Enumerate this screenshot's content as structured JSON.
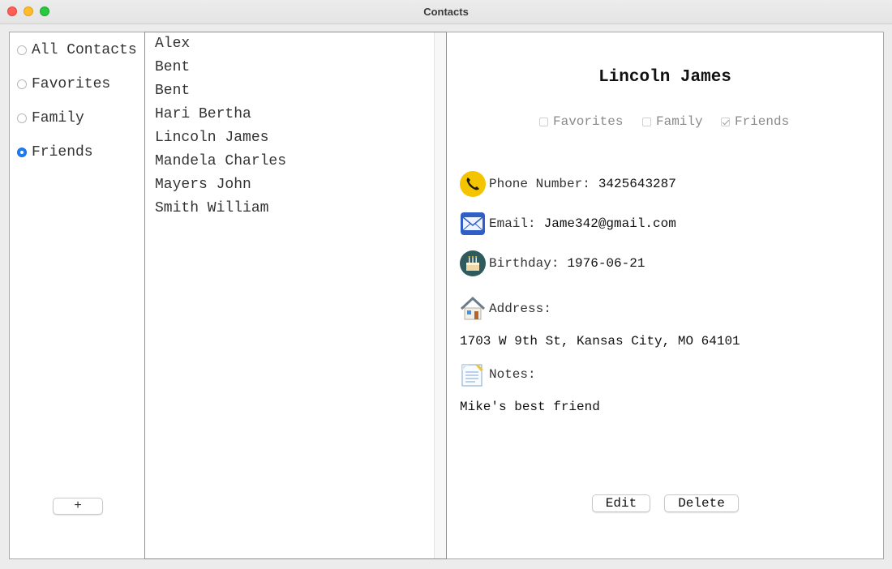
{
  "window": {
    "title": "Contacts"
  },
  "sidebar": {
    "groups": [
      {
        "label": "All Contacts",
        "selected": false
      },
      {
        "label": "Favorites",
        "selected": false
      },
      {
        "label": "Family",
        "selected": false
      },
      {
        "label": "Friends",
        "selected": true
      }
    ],
    "add_label": "+"
  },
  "contact_list": {
    "items": [
      "Alex",
      "Bent",
      "Bent",
      "Hari Bertha",
      "Lincoln James",
      "Mandela Charles",
      "Mayers John",
      "Smith William"
    ]
  },
  "detail": {
    "name": "Lincoln James",
    "tags": [
      {
        "label": "Favorites",
        "checked": false
      },
      {
        "label": "Family",
        "checked": false
      },
      {
        "label": "Friends",
        "checked": true
      }
    ],
    "phone": {
      "label": "Phone Number:",
      "value": "3425643287",
      "icon": "phone-icon"
    },
    "email": {
      "label": "Email:",
      "value": "Jame342@gmail.com",
      "icon": "envelope-icon"
    },
    "birthday": {
      "label": "Birthday:",
      "value": "1976-06-21",
      "icon": "cake-icon"
    },
    "address": {
      "label": "Address:",
      "value": "1703 W 9th St, Kansas City, MO 64101",
      "icon": "house-icon"
    },
    "notes": {
      "label": "Notes:",
      "value": "Mike's best friend",
      "icon": "notepad-icon"
    },
    "edit_label": "Edit",
    "delete_label": "Delete"
  },
  "colors": {
    "accent": "#1f7cf7",
    "phone_badge": "#f5c400",
    "birthday_badge": "#2f5a5e"
  }
}
